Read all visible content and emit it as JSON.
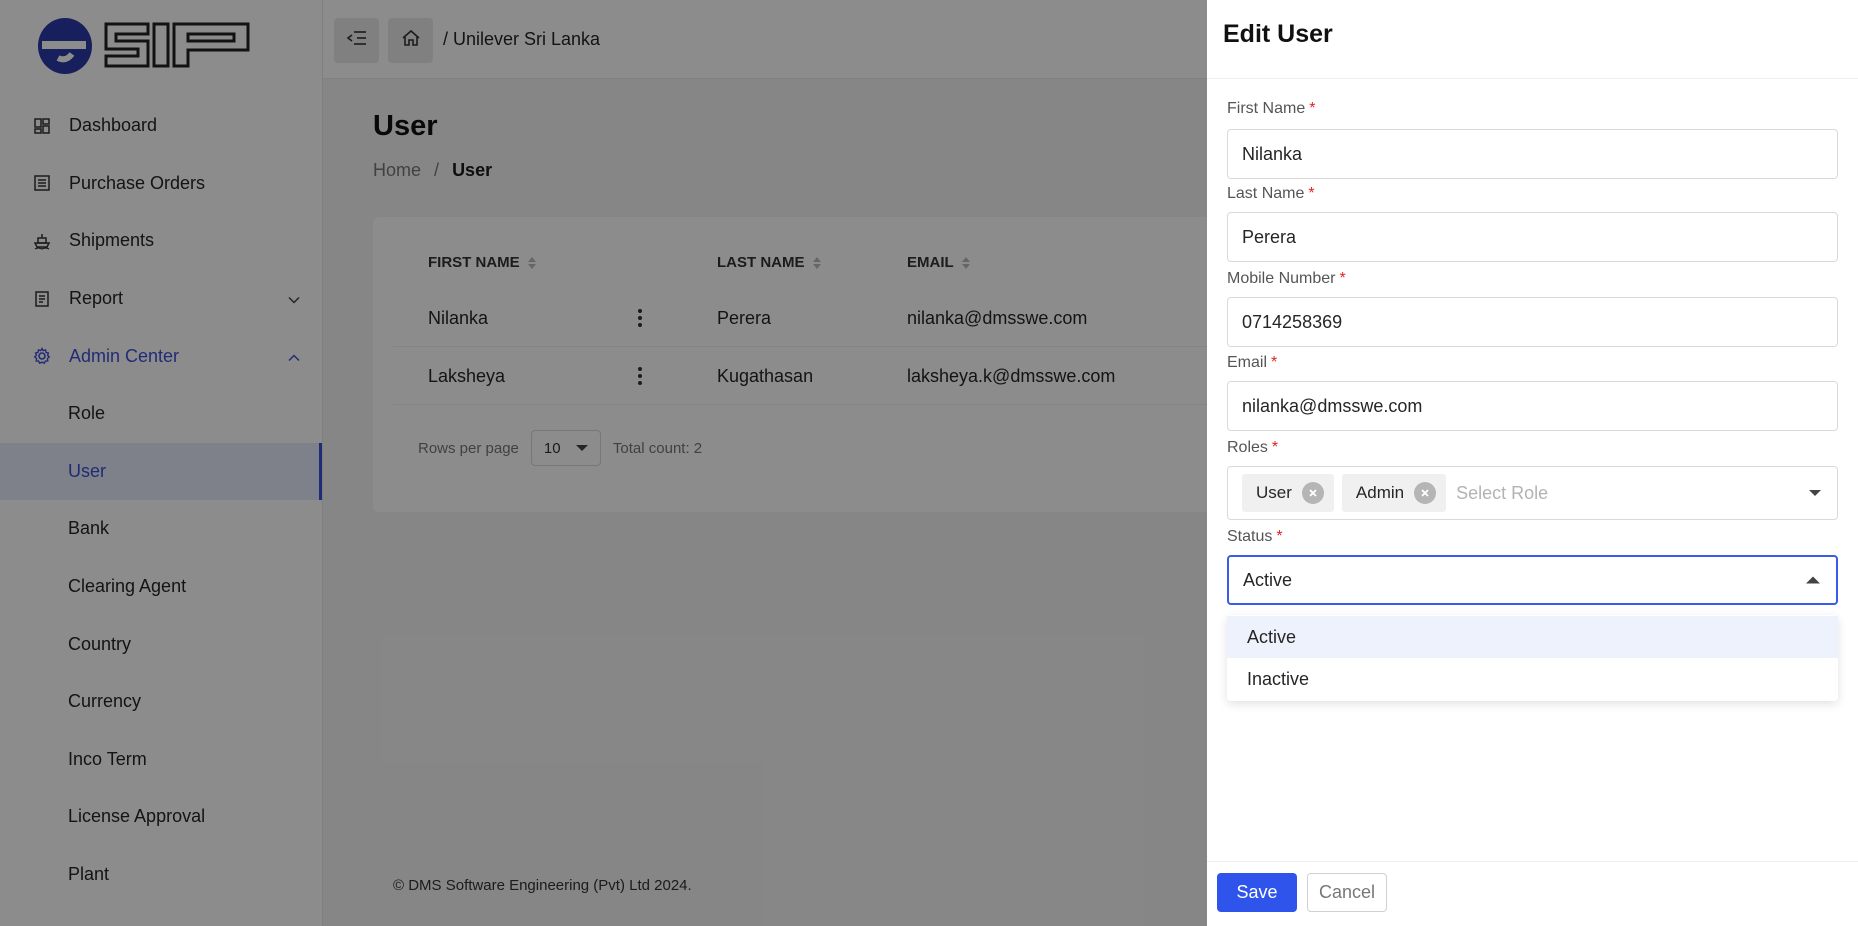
{
  "brand": {
    "logo_text": "eSIP",
    "accent": "#2b3aa8"
  },
  "topbar": {
    "breadcrumb": "/ Unilever Sri Lanka"
  },
  "sidebar": {
    "items": [
      {
        "label": "Dashboard",
        "icon": "dashboard-icon"
      },
      {
        "label": "Purchase Orders",
        "icon": "list-icon"
      },
      {
        "label": "Shipments",
        "icon": "ship-icon"
      },
      {
        "label": "Report",
        "icon": "report-icon"
      },
      {
        "label": "Admin Center",
        "icon": "gear-icon"
      },
      {
        "label": "Role"
      },
      {
        "label": "User"
      },
      {
        "label": "Bank"
      },
      {
        "label": "Clearing Agent"
      },
      {
        "label": "Country"
      },
      {
        "label": "Currency"
      },
      {
        "label": "Inco Term"
      },
      {
        "label": "License Approval"
      },
      {
        "label": "Plant"
      }
    ]
  },
  "page": {
    "title": "User",
    "breadcrumb_home": "Home",
    "breadcrumb_sep": "/",
    "breadcrumb_current": "User"
  },
  "table": {
    "columns": [
      "FIRST NAME",
      "LAST NAME",
      "EMAIL"
    ],
    "rows": [
      {
        "first": "Nilanka",
        "last": "Perera",
        "email": "nilanka@dmsswe.com"
      },
      {
        "first": "Laksheya",
        "last": "Kugathasan",
        "email": "laksheya.k@dmsswe.com"
      }
    ],
    "rows_per_page_label": "Rows per page",
    "rows_per_page": "10",
    "total": "Total count: 2"
  },
  "footer": "© DMS Software Engineering (Pvt) Ltd 2024.",
  "drawer": {
    "title": "Edit User",
    "first_name_label": "First Name",
    "first_name": "Nilanka",
    "last_name_label": "Last Name",
    "last_name": "Perera",
    "mobile_label": "Mobile Number",
    "mobile": "0714258369",
    "email_label": "Email",
    "email": "nilanka@dmsswe.com",
    "roles_label": "Roles",
    "roles": [
      "User",
      "Admin"
    ],
    "roles_placeholder": "Select Role",
    "status_label": "Status",
    "status": "Active",
    "status_options": [
      "Active",
      "Inactive"
    ],
    "required_mark": "*",
    "save": "Save",
    "cancel": "Cancel"
  }
}
